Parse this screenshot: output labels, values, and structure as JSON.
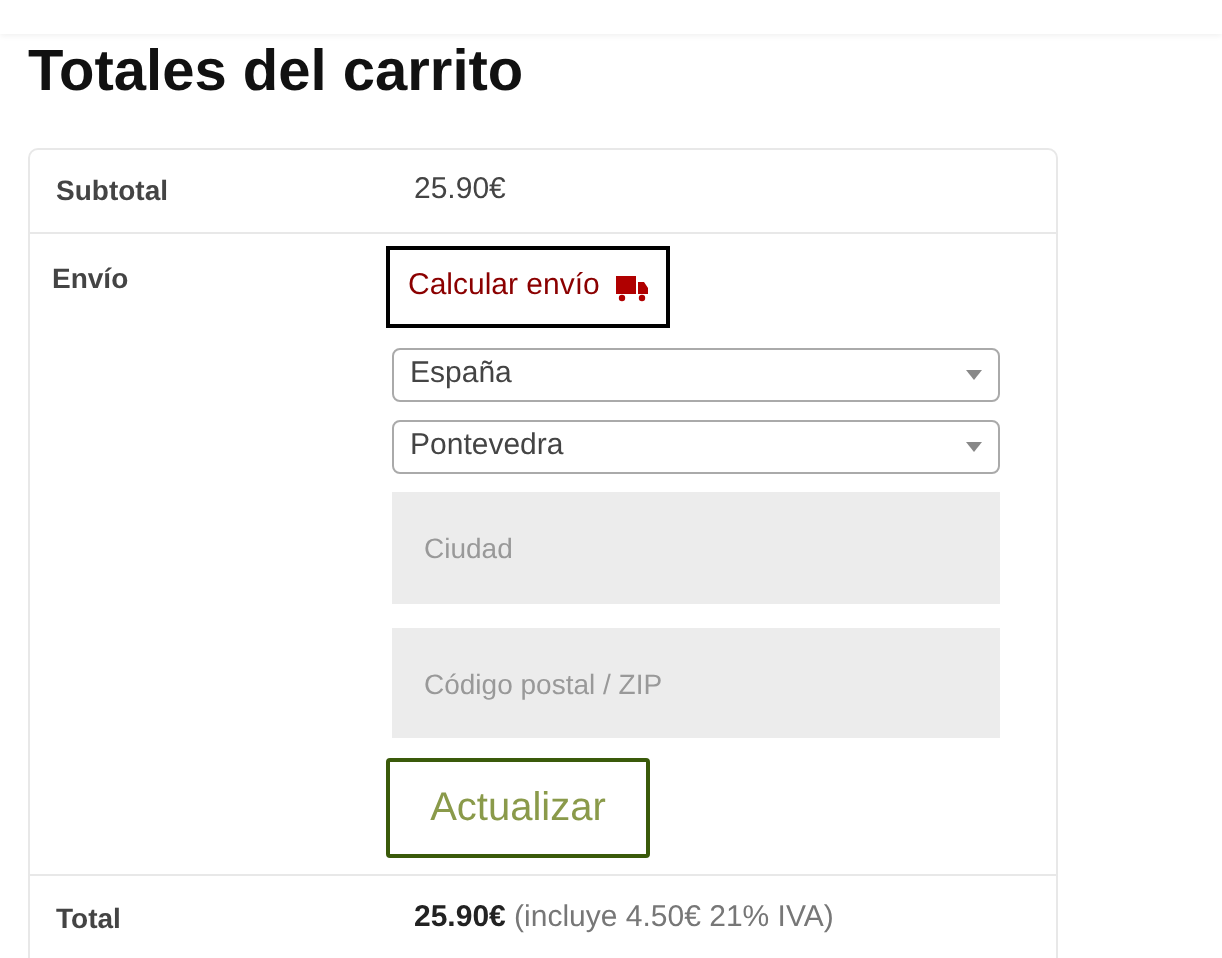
{
  "title": "Totales del carrito",
  "subtotal": {
    "label": "Subtotal",
    "value": "25.90€"
  },
  "shipping": {
    "label": "Envío",
    "calculate_link": "Calcular envío",
    "country": "España",
    "state": "Pontevedra",
    "city": {
      "placeholder": "Ciudad"
    },
    "postcode": {
      "placeholder": "Código postal / ZIP"
    },
    "update_button": "Actualizar"
  },
  "total": {
    "label": "Total",
    "value": "**25.90€** (incluye 4.50€ 21% IVA)"
  }
}
